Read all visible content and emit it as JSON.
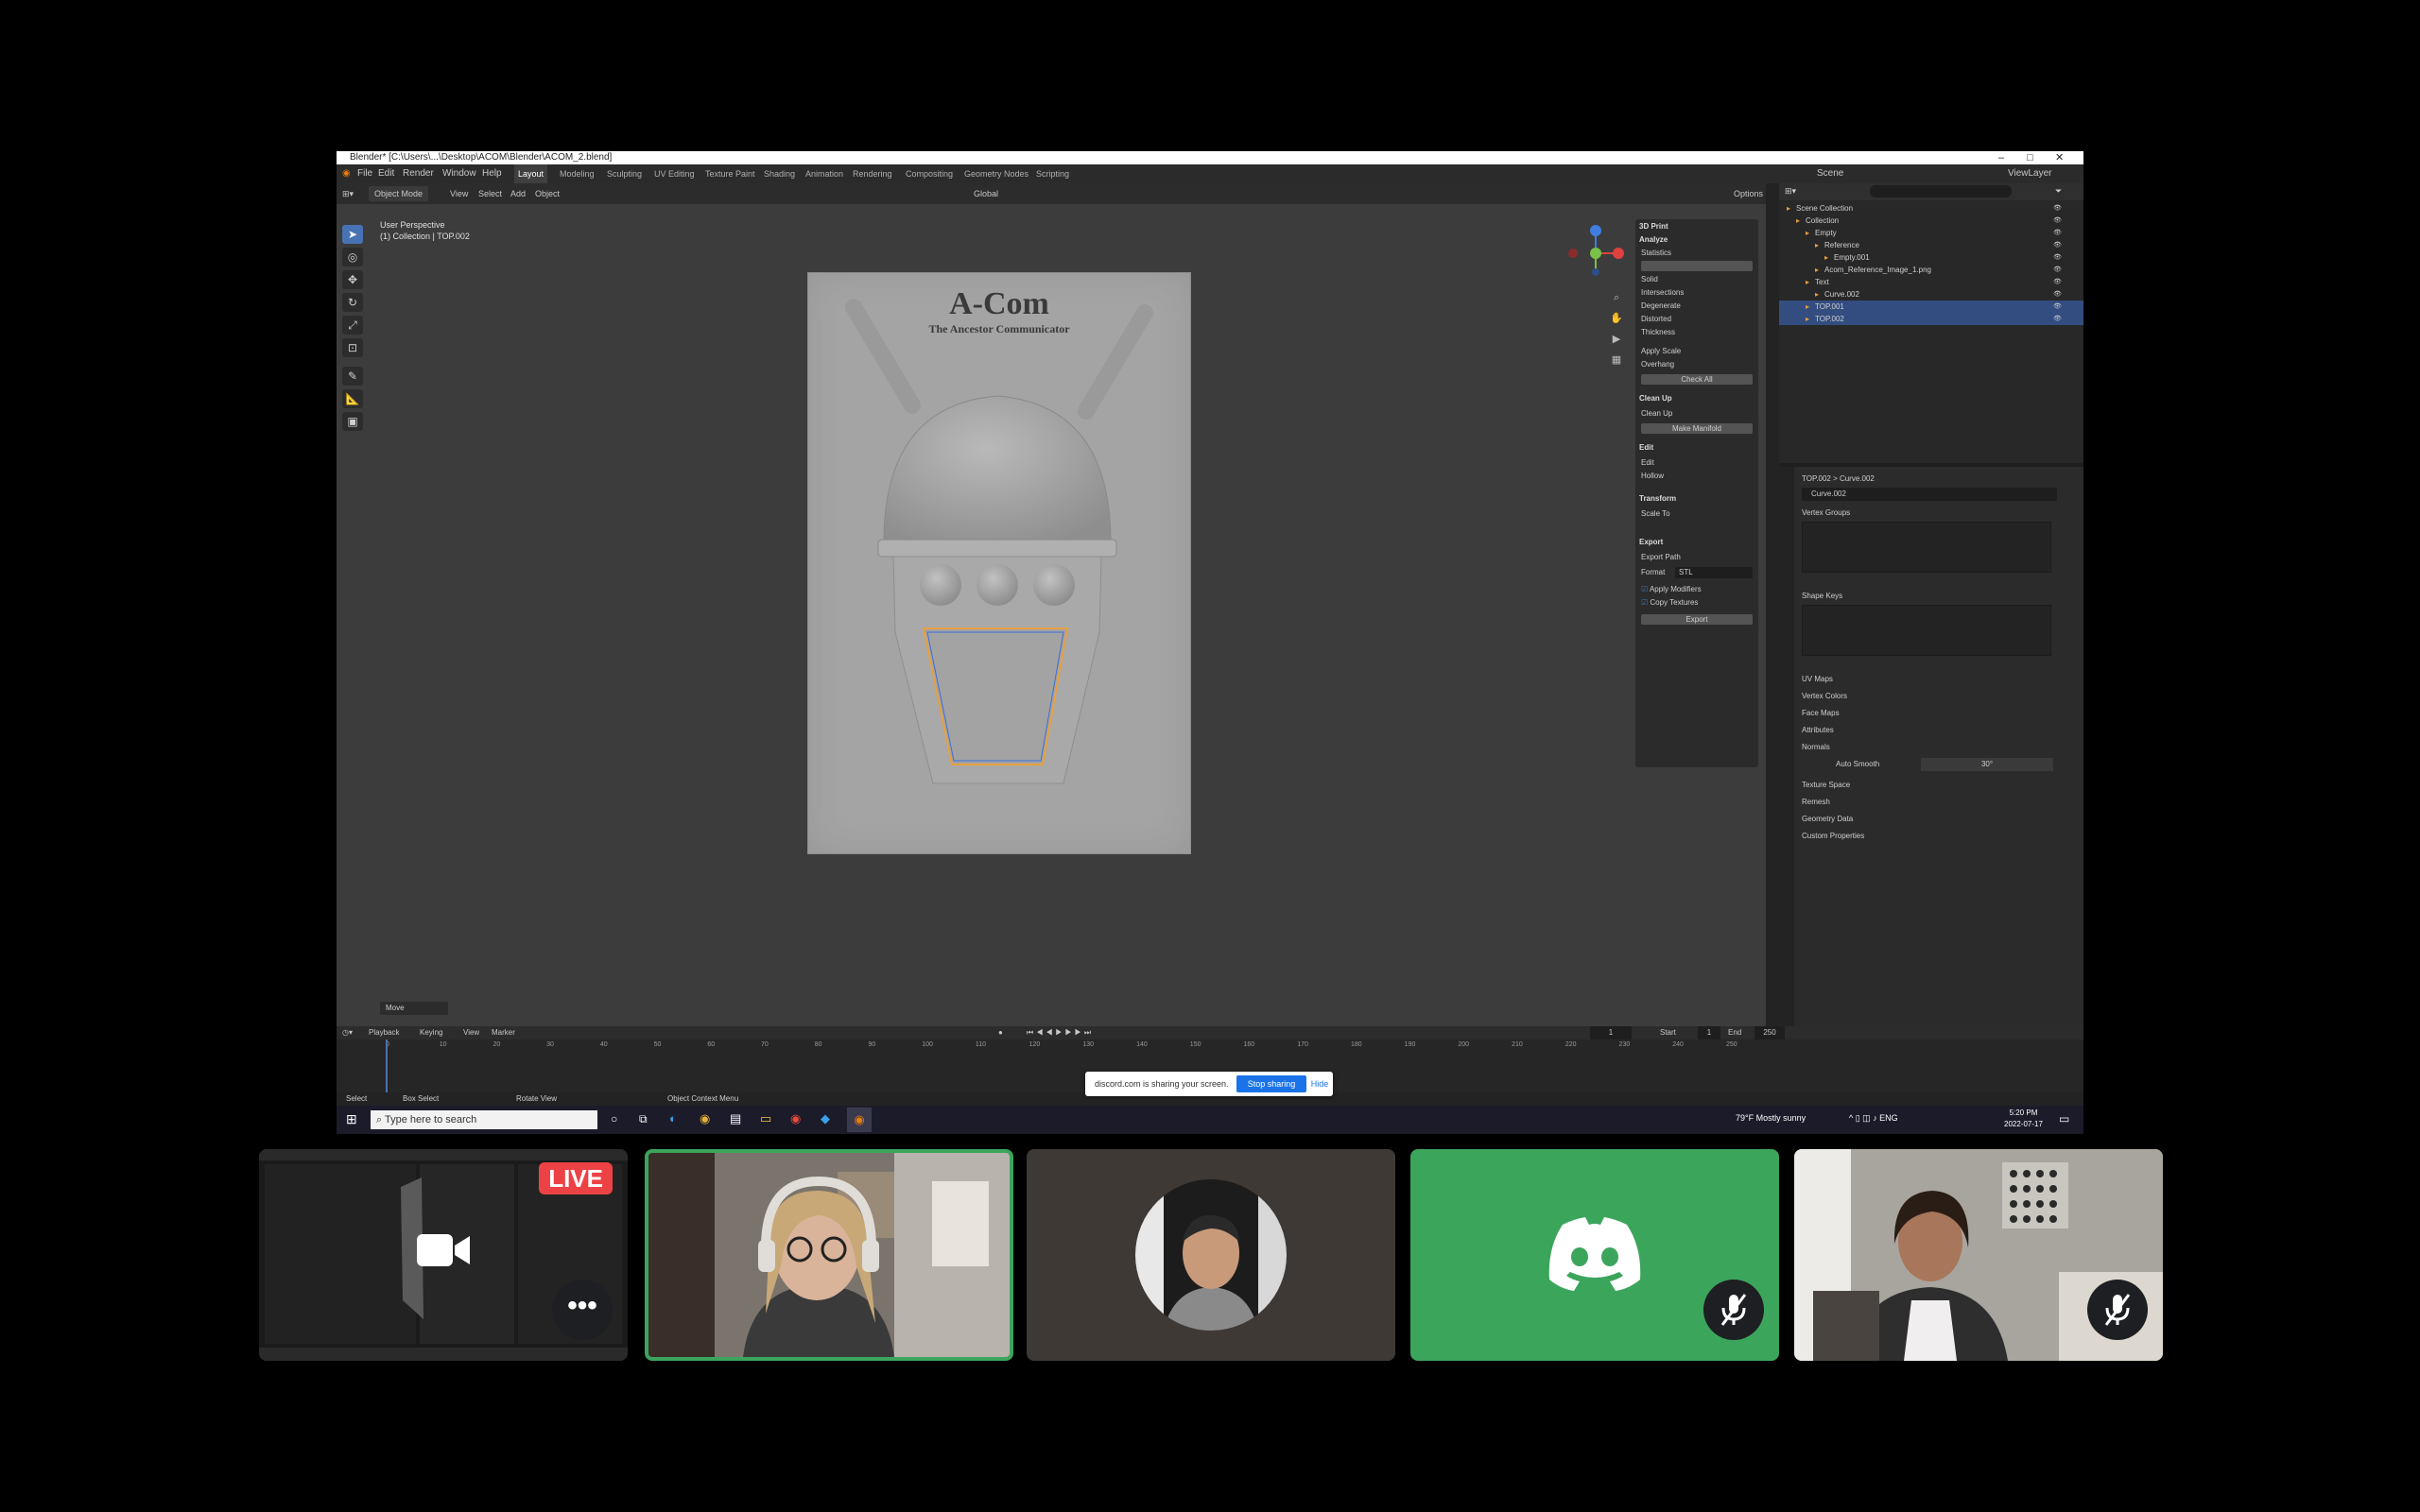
{
  "window": {
    "title": "Blender* [C:\\Users\\...\\Desktop\\ACOM\\Blender\\ACOM_2.blend]",
    "controls": [
      "–",
      "□",
      "✕"
    ]
  },
  "menubar": {
    "items": [
      "File",
      "Edit",
      "Render",
      "Window",
      "Help"
    ],
    "workspaces": [
      "Layout",
      "Modeling",
      "Sculpting",
      "UV Editing",
      "Texture Paint",
      "Shading",
      "Animation",
      "Rendering",
      "Compositing",
      "Geometry Nodes",
      "Scripting"
    ],
    "active_workspace": "Layout",
    "scene": "Scene",
    "view_layer": "ViewLayer"
  },
  "viewport_header": {
    "mode": "Object Mode",
    "menus": [
      "View",
      "Select",
      "Add",
      "Object"
    ],
    "transform": "Global",
    "options": "Options"
  },
  "viewport": {
    "view_name": "User Perspective",
    "collection_info": "(1) Collection | TOP.002",
    "logo_title": "A-Com",
    "logo_subtitle": "The Ancestor Communicator",
    "status_corner": "Move"
  },
  "npanel": {
    "header": "3D Print",
    "sections": [
      "Analyze",
      "Clean Up",
      "Edit",
      "Transform",
      "Export"
    ],
    "rows": [
      "Statistics",
      "Solid",
      "Intersections",
      "Degenerate",
      "Distorted",
      "Thickness",
      "Apply Scale",
      "Overhang",
      "Check All",
      "Clean Up",
      "Make Manifold",
      "Edit",
      "Hollow",
      "Scale To",
      "Export Path"
    ],
    "checkboxes": [
      "Apply Modifiers",
      "Copy Textures"
    ],
    "format_label": "Format",
    "format_value": "STL",
    "export_button": "Export"
  },
  "outliner": {
    "rows": [
      {
        "label": "Scene Collection",
        "indent": 0,
        "selected": false
      },
      {
        "label": "Collection",
        "indent": 1,
        "selected": false
      },
      {
        "label": "Empty",
        "indent": 2,
        "selected": false
      },
      {
        "label": "Reference",
        "indent": 3,
        "selected": false
      },
      {
        "label": "Empty.001",
        "indent": 4,
        "selected": false
      },
      {
        "label": "Acom_Reference_Image_1.png",
        "indent": 3,
        "selected": false
      },
      {
        "label": "Text",
        "indent": 2,
        "selected": false
      },
      {
        "label": "Curve.002",
        "indent": 3,
        "selected": false
      },
      {
        "label": "TOP.001",
        "indent": 2,
        "selected": true
      },
      {
        "label": "TOP.002",
        "indent": 2,
        "selected": true
      }
    ]
  },
  "properties": {
    "breadcrumb": "TOP.002 > Curve.002",
    "data_name": "Curve.002",
    "sections": [
      "Vertex Groups",
      "Shape Keys",
      "UV Maps",
      "Vertex Colors",
      "Face Maps",
      "Attributes",
      "Normals",
      "Texture Space",
      "Remesh",
      "Geometry Data",
      "Custom Properties"
    ],
    "auto_smooth_label": "Auto Smooth",
    "auto_smooth_value": "30°"
  },
  "timeline": {
    "menus": [
      "Playback",
      "Keying",
      "View",
      "Marker"
    ],
    "current_frame": "1",
    "start_label": "Start",
    "start_value": "1",
    "end_label": "End",
    "end_value": "250",
    "ticks": [
      "0",
      "10",
      "20",
      "30",
      "40",
      "50",
      "60",
      "70",
      "80",
      "90",
      "100",
      "110",
      "120",
      "130",
      "140",
      "150",
      "160",
      "170",
      "180",
      "190",
      "200",
      "210",
      "220",
      "230",
      "240",
      "250"
    ],
    "status_items": [
      "Select",
      "Box Select",
      "Rotate View",
      "Object Context Menu"
    ]
  },
  "taskbar": {
    "search_placeholder": "Type here to search",
    "weather": "79°F Mostly sunny",
    "time": "5:20 PM",
    "date": "2022-07-17"
  },
  "share_bar": {
    "message": "discord.com is sharing your screen.",
    "stop_label": "Stop sharing",
    "hide_label": "Hide"
  },
  "participants": {
    "live_badge": "LIVE",
    "more_label": "•••"
  },
  "colors": {
    "speaking_border": "#3ba55c",
    "discord_green": "#3ba55c",
    "live_red": "#ed4245",
    "blender_accent": "#4772b3",
    "share_blue": "#1a73e8"
  }
}
